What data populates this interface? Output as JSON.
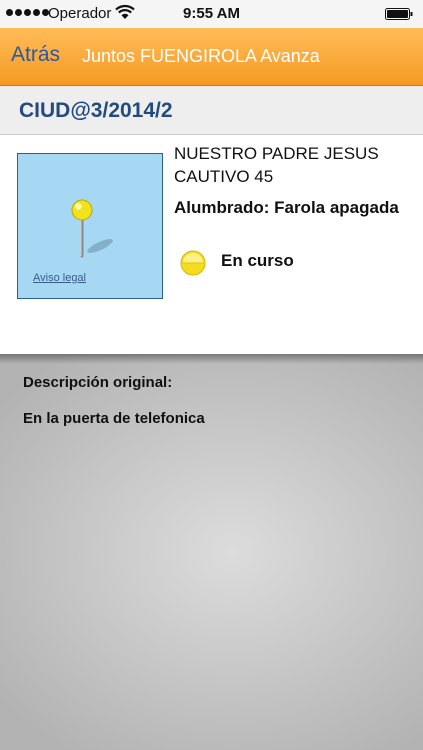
{
  "status_bar": {
    "carrier": "Operador",
    "time": "9:55 AM",
    "signal_icon": "signal-dots-icon",
    "wifi_icon": "wifi-icon",
    "battery_icon": "battery-icon"
  },
  "nav": {
    "back_label": "Atrás",
    "title": "Juntos FUENGIROLA Avanza",
    "bar_color": "#f59a23",
    "back_color": "#2c5aa0"
  },
  "incident": {
    "reference": "CIUD@3/2014/2",
    "address": "NUESTRO PADRE JESUS CAUTIVO 45",
    "category": "Alumbrado: Farola apagada",
    "status": "En curso",
    "status_color": "#f5dc1e",
    "status_icon": "status-dot-icon"
  },
  "map": {
    "legal_link": "Aviso legal",
    "pin_icon": "map-pin-icon"
  },
  "description": {
    "label": "Descripción original:",
    "text": "En la puerta de telefonica"
  }
}
